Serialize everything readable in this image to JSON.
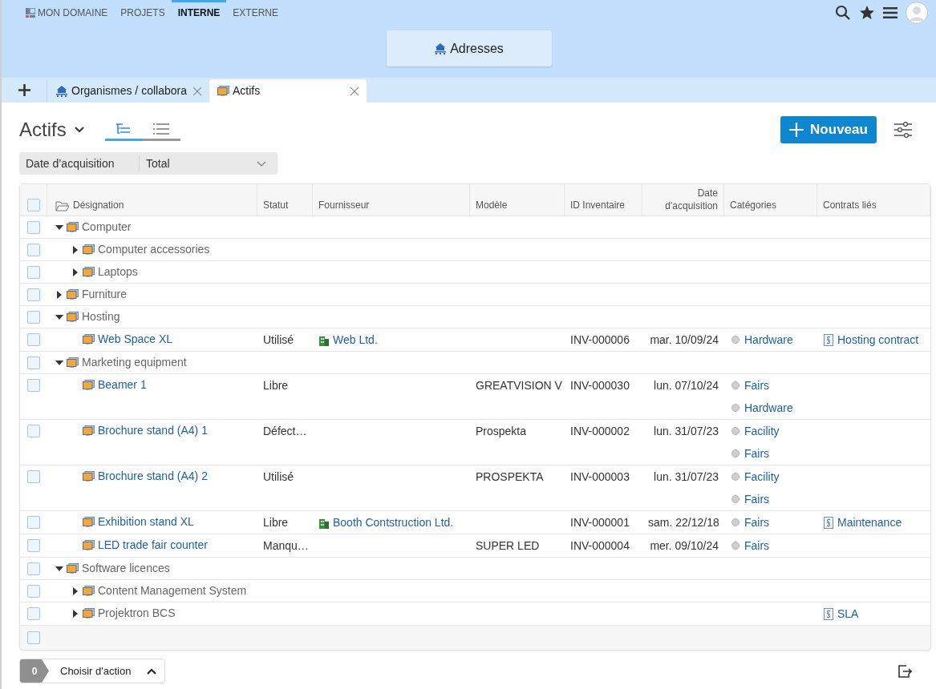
{
  "nav": {
    "tabs": [
      {
        "label": "MON DOMAINE",
        "selected": false,
        "kind": "home"
      },
      {
        "label": "PROJETS",
        "selected": false
      },
      {
        "label": "INTERNE",
        "selected": true
      },
      {
        "label": "EXTERNE",
        "selected": false
      }
    ]
  },
  "header": {
    "center_button": "Adresses"
  },
  "doc_tabs": [
    {
      "label": "Organismes / collabora",
      "selected": false,
      "kind": "org"
    },
    {
      "label": "Actifs",
      "selected": true,
      "kind": "asset"
    }
  ],
  "title": "Actifs",
  "views": [
    {
      "kind": "tree",
      "selected": true
    },
    {
      "kind": "list",
      "selected": false
    }
  ],
  "new_button": "Nouveau",
  "filter": {
    "label": "Date d’acquisition",
    "value": "Total"
  },
  "table": {
    "header_checked": false,
    "footer_checked": false,
    "columns": [
      "Désignation",
      "Statut",
      "Fournisseur",
      "Modèle",
      "ID Inventaire",
      "Date d'acquisition",
      "Catégories",
      "Contrats liés"
    ],
    "rows": [
      {
        "name": "Computer",
        "kind": "group",
        "expanded": true,
        "checked": false,
        "children": [
          {
            "name": "Computer accessories",
            "kind": "group",
            "expanded": false,
            "checked": false
          },
          {
            "name": "Laptops",
            "kind": "group",
            "expanded": false,
            "checked": false
          }
        ]
      },
      {
        "name": "Furniture",
        "kind": "group",
        "expanded": false,
        "checked": false
      },
      {
        "name": "Hosting",
        "kind": "group",
        "expanded": true,
        "checked": false,
        "children": [
          {
            "name": "Web Space XL",
            "kind": "item",
            "checked": false,
            "status": "Utilisé",
            "supplier": "Web Ltd.",
            "inventory_id": "INV-000006",
            "date": "mar. 10/09/24",
            "categories": [
              "Hardware"
            ],
            "contracts": [
              "Hosting contract"
            ]
          }
        ]
      },
      {
        "name": "Marketing equipment",
        "kind": "group",
        "expanded": true,
        "checked": false,
        "children": [
          {
            "name": "Beamer 1",
            "kind": "item",
            "checked": false,
            "status": "Libre",
            "model": "GREATVISION V",
            "inventory_id": "INV-000030",
            "date": "lun. 07/10/24",
            "categories": [
              "Fairs",
              "Hardware"
            ]
          },
          {
            "name": "Brochure stand (A4) 1",
            "kind": "item",
            "checked": false,
            "status": "Défect…",
            "model": "Prospekta",
            "inventory_id": "INV-000002",
            "date": "lun. 31/07/23",
            "categories": [
              "Facility",
              "Fairs"
            ]
          },
          {
            "name": "Brochure stand (A4) 2",
            "kind": "item",
            "checked": false,
            "status": "Utilisé",
            "model": "PROSPEKTA",
            "inventory_id": "INV-000003",
            "date": "lun. 31/07/23",
            "categories": [
              "Facility",
              "Fairs"
            ]
          },
          {
            "name": "Exhibition stand XL",
            "kind": "item",
            "checked": false,
            "status": "Libre",
            "supplier": "Booth Contstruction Ltd.",
            "inventory_id": "INV-000001",
            "date": "sam. 22/12/18",
            "categories": [
              "Fairs"
            ],
            "contracts": [
              "Maintenance"
            ]
          },
          {
            "name": "LED trade fair counter",
            "kind": "item",
            "checked": false,
            "status": "Manqu…",
            "model": "SUPER LED",
            "inventory_id": "INV-000004",
            "date": "mer. 09/10/24",
            "categories": [
              "Fairs"
            ]
          }
        ]
      },
      {
        "name": "Software licences",
        "kind": "group",
        "expanded": true,
        "checked": false,
        "children": [
          {
            "name": "Content Management System",
            "kind": "group",
            "expanded": false,
            "checked": false
          },
          {
            "name": "Projektron BCS",
            "kind": "group",
            "expanded": false,
            "checked": false,
            "contracts": [
              "SLA"
            ]
          }
        ]
      }
    ]
  },
  "action_bar": {
    "count": "0",
    "label": "Choisir d'action"
  }
}
